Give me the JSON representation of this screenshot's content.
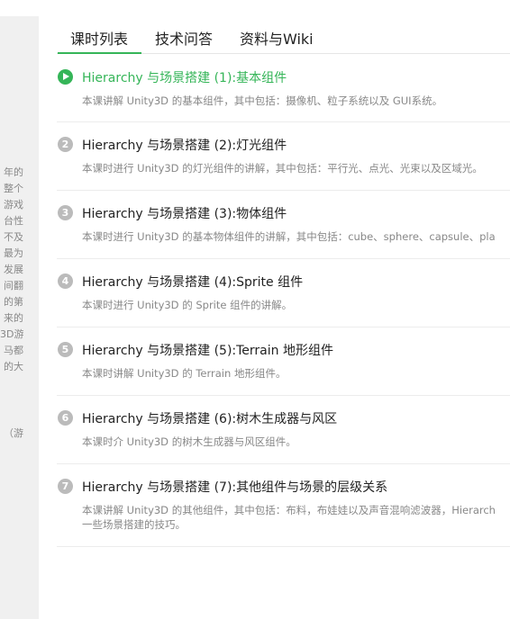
{
  "sidebar": {
    "text_lines": [
      "年的",
      "整个",
      "游戏",
      "台性",
      "不及",
      "最为",
      "发展",
      "间翻",
      "的第",
      "来的",
      "3D游",
      "马都",
      "的大"
    ],
    "tail": "（游"
  },
  "tabs": [
    {
      "label": "课时列表",
      "active": true
    },
    {
      "label": "技术问答",
      "active": false
    },
    {
      "label": "资料与Wiki",
      "active": false
    }
  ],
  "lessons": [
    {
      "index": "1",
      "title": "Hierarchy 与场景搭建 (1):基本组件",
      "desc": "本课讲解 Unity3D 的基本组件，其中包括：摄像机、粒子系统以及 GUI系统。",
      "playing": true
    },
    {
      "index": "2",
      "title": "Hierarchy 与场景搭建 (2):灯光组件",
      "desc": "本课时进行 Unity3D 的灯光组件的讲解，其中包括：平行光、点光、光束以及区域光。",
      "playing": false
    },
    {
      "index": "3",
      "title": "Hierarchy 与场景搭建 (3):物体组件",
      "desc": "本课时进行 Unity3D 的基本物体组件的讲解，其中包括：cube、sphere、capsule、pla",
      "playing": false
    },
    {
      "index": "4",
      "title": "Hierarchy 与场景搭建 (4):Sprite 组件",
      "desc": "本课时进行 Unity3D 的 Sprite 组件的讲解。",
      "playing": false
    },
    {
      "index": "5",
      "title": "Hierarchy 与场景搭建 (5):Terrain 地形组件",
      "desc": "本课时讲解 Unity3D 的 Terrain 地形组件。",
      "playing": false
    },
    {
      "index": "6",
      "title": "Hierarchy 与场景搭建 (6):树木生成器与风区",
      "desc": "本课时介 Unity3D 的树木生成器与风区组件。",
      "playing": false
    },
    {
      "index": "7",
      "title": "Hierarchy 与场景搭建 (7):其他组件与场景的层级关系",
      "desc": "本课讲解 Unity3D 的其他组件，其中包括：布料，布娃娃以及声音混响滤波器，Hierarch",
      "desc2": "一些场景搭建的技巧。",
      "playing": false
    }
  ],
  "colors": {
    "accent": "#35b558",
    "badge": "#bbbbbb"
  },
  "icons": {
    "play": "play-icon"
  }
}
